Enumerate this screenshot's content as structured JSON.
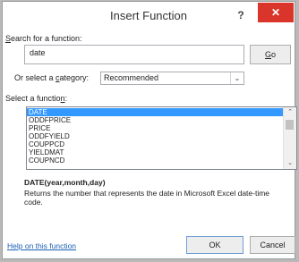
{
  "dialog": {
    "title": "Insert Function",
    "help_glyph": "?",
    "close_glyph": "✕"
  },
  "search": {
    "label_key": "S",
    "label_rest": "earch for a function:",
    "value": "date",
    "go_key": "G",
    "go_rest": "o"
  },
  "category": {
    "label_pre": "Or select a ",
    "label_key": "c",
    "label_post": "ategory:",
    "selected": "Recommended",
    "arrow_glyph": "⌄"
  },
  "functions": {
    "label_pre": "Select a functio",
    "label_key": "n",
    "label_post": ":",
    "items": [
      "DATE",
      "ODDFPRICE",
      "PRICE",
      "ODDFYIELD",
      "COUPPCD",
      "YIELDMAT",
      "COUPNCD"
    ],
    "selected_index": 0,
    "scroll_up_glyph": "⌃",
    "scroll_down_glyph": "⌄"
  },
  "details": {
    "signature": "DATE(year,month,day)",
    "description": "Returns the number that represents the date in Microsoft Excel date-time code."
  },
  "footer": {
    "help_link": "Help on this function",
    "ok_label": "OK",
    "cancel_label": "Cancel"
  }
}
